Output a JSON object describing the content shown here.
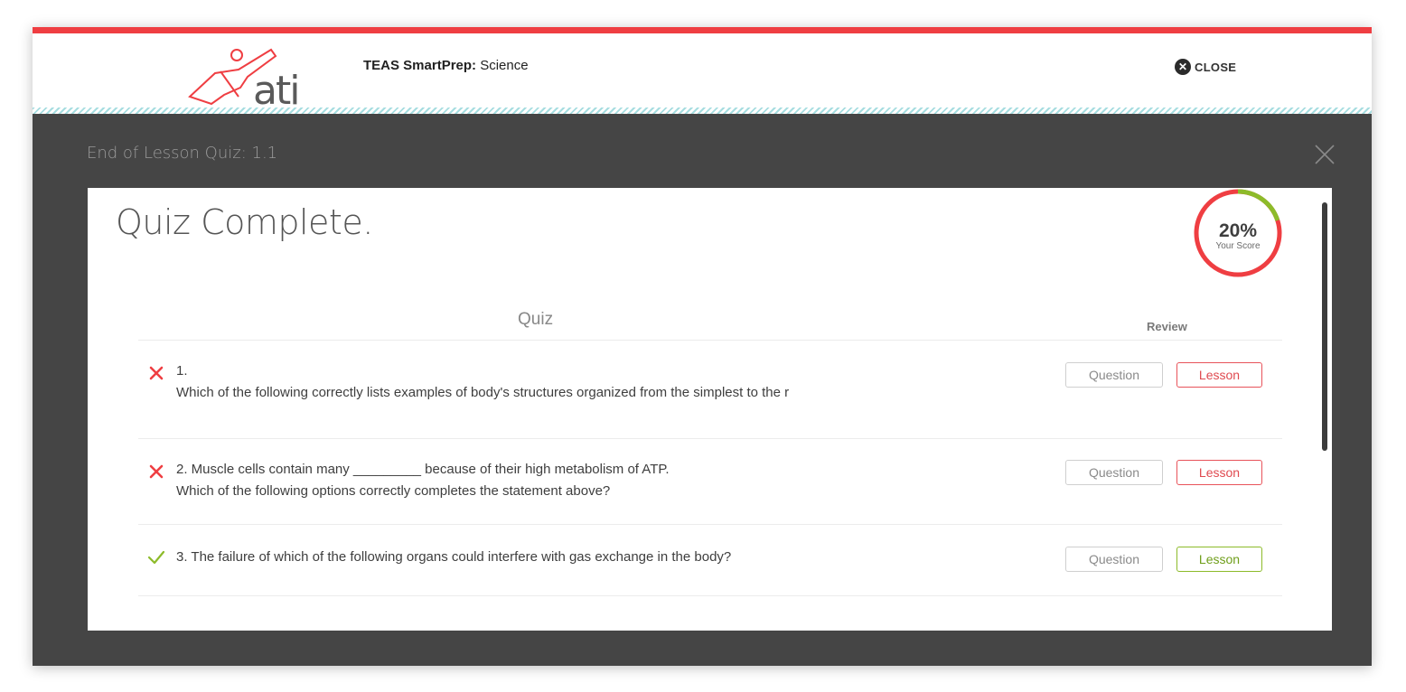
{
  "header": {
    "logo_text": "ati",
    "app_name": "TEAS SmartPrep:",
    "subject": "Science",
    "close_label": "CLOSE"
  },
  "modal": {
    "title": "End of Lesson Quiz: 1.1",
    "heading": "Quiz Complete.",
    "score": {
      "value": 0.2,
      "percent_label": "20%",
      "label": "Your Score"
    },
    "columns": {
      "quiz": "Quiz",
      "review": "Review"
    },
    "questions": [
      {
        "status": "incorrect",
        "line1": "1.",
        "line2": "Which of the following correctly lists examples of body's structures organized from the simplest to the r",
        "question_button": "Question",
        "lesson_button": "Lesson"
      },
      {
        "status": "incorrect",
        "line1": "2. Muscle cells contain many _________ because of their high metabolism of ATP.",
        "line2": "Which of the following options correctly completes the statement above?",
        "question_button": "Question",
        "lesson_button": "Lesson"
      },
      {
        "status": "correct",
        "line1": "3. The failure of which of the following organs could interfere with gas exchange in the body?",
        "question_button": "Question",
        "lesson_button": "Lesson"
      }
    ]
  },
  "colors": {
    "accent_red": "#ef3e42",
    "correct_green": "#8dbb2a",
    "overlay": "#454545"
  }
}
